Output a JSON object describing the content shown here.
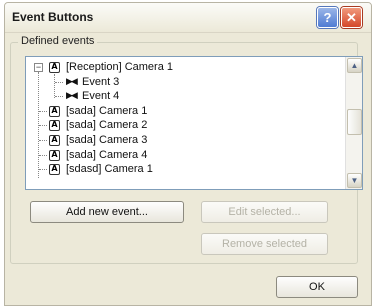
{
  "window": {
    "title": "Event Buttons",
    "help_glyph": "?",
    "close_glyph": "✕"
  },
  "group": {
    "label": "Defined events"
  },
  "tree": {
    "expander_glyph": "−",
    "camera_glyph": "A",
    "event_glyph": "▶◀",
    "items": [
      {
        "label": "[Reception] Camera 1"
      },
      {
        "label": "Event 3"
      },
      {
        "label": "Event 4"
      },
      {
        "label": "[sada] Camera 1"
      },
      {
        "label": "[sada] Camera 2"
      },
      {
        "label": "[sada] Camera 3"
      },
      {
        "label": "[sada] Camera 4"
      },
      {
        "label": "[sdasd] Camera 1"
      }
    ],
    "scroll_up_glyph": "▲",
    "scroll_down_glyph": "▼"
  },
  "buttons": {
    "add": "Add new event...",
    "edit": "Edit selected...",
    "remove": "Remove selected",
    "ok": "OK"
  },
  "colors": {
    "dialog_bg": "#ece9d8",
    "tree_border": "#7f9db9",
    "disabled_text": "#b4b2a6"
  }
}
